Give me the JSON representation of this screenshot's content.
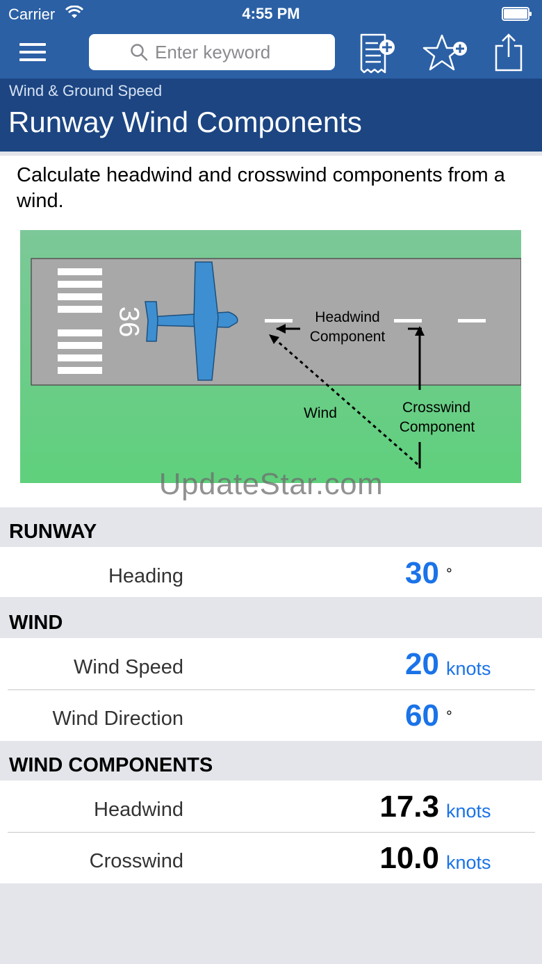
{
  "status_bar": {
    "carrier": "Carrier",
    "time": "4:55 PM"
  },
  "search": {
    "placeholder": "Enter keyword"
  },
  "header": {
    "breadcrumb": "Wind & Ground Speed",
    "title": "Runway Wind Components"
  },
  "description": "Calculate headwind and crosswind components from a wind.",
  "diagram": {
    "runway_number": "36",
    "headwind_label_1": "Headwind",
    "headwind_label_2": "Component",
    "crosswind_label_1": "Crosswind",
    "crosswind_label_2": "Component",
    "wind_label": "Wind"
  },
  "watermark": "UpdateStar.com",
  "sections": {
    "runway": {
      "title": "RUNWAY",
      "heading": {
        "label": "Heading",
        "value": "30",
        "unit": "°"
      }
    },
    "wind": {
      "title": "WIND",
      "speed": {
        "label": "Wind Speed",
        "value": "20",
        "unit": "knots"
      },
      "direction": {
        "label": "Wind Direction",
        "value": "60",
        "unit": "°"
      }
    },
    "components": {
      "title": "WIND COMPONENTS",
      "headwind": {
        "label": "Headwind",
        "value": "17.3",
        "unit": "knots"
      },
      "crosswind": {
        "label": "Crosswind",
        "value": "10.0",
        "unit": "knots"
      }
    }
  },
  "colors": {
    "nav_bar": "#2b60a5",
    "title_bar": "#1c4582",
    "accent": "#1a73e8",
    "grass": "#5fce7c",
    "runway": "#a8a8a8",
    "airplane": "#3d8fd1"
  }
}
